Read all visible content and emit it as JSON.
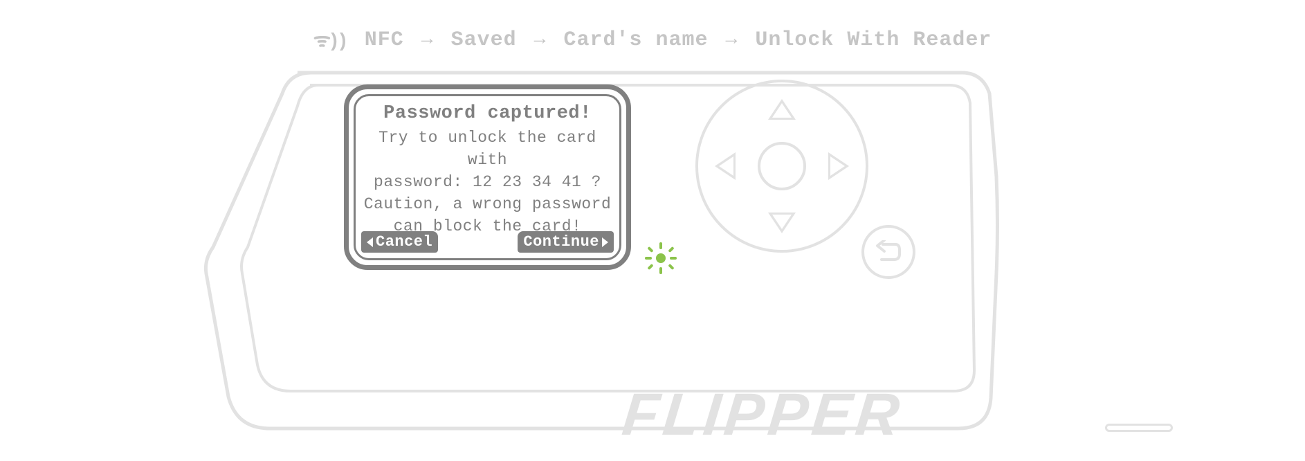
{
  "breadcrumb": {
    "icon": "nfc",
    "items": [
      "NFC",
      "Saved",
      "Card's name",
      "Unlock With Reader"
    ]
  },
  "screen": {
    "title": "Password captured!",
    "line1": "Try to unlock the card with",
    "line2": "password: 12 23 34 41 ?",
    "line3": "Caution, a wrong password",
    "line4": "can block the card!",
    "cancel_label": "Cancel",
    "continue_label": "Continue"
  },
  "device": {
    "brand": "FLIPPER",
    "led_color": "#8bc34a"
  }
}
